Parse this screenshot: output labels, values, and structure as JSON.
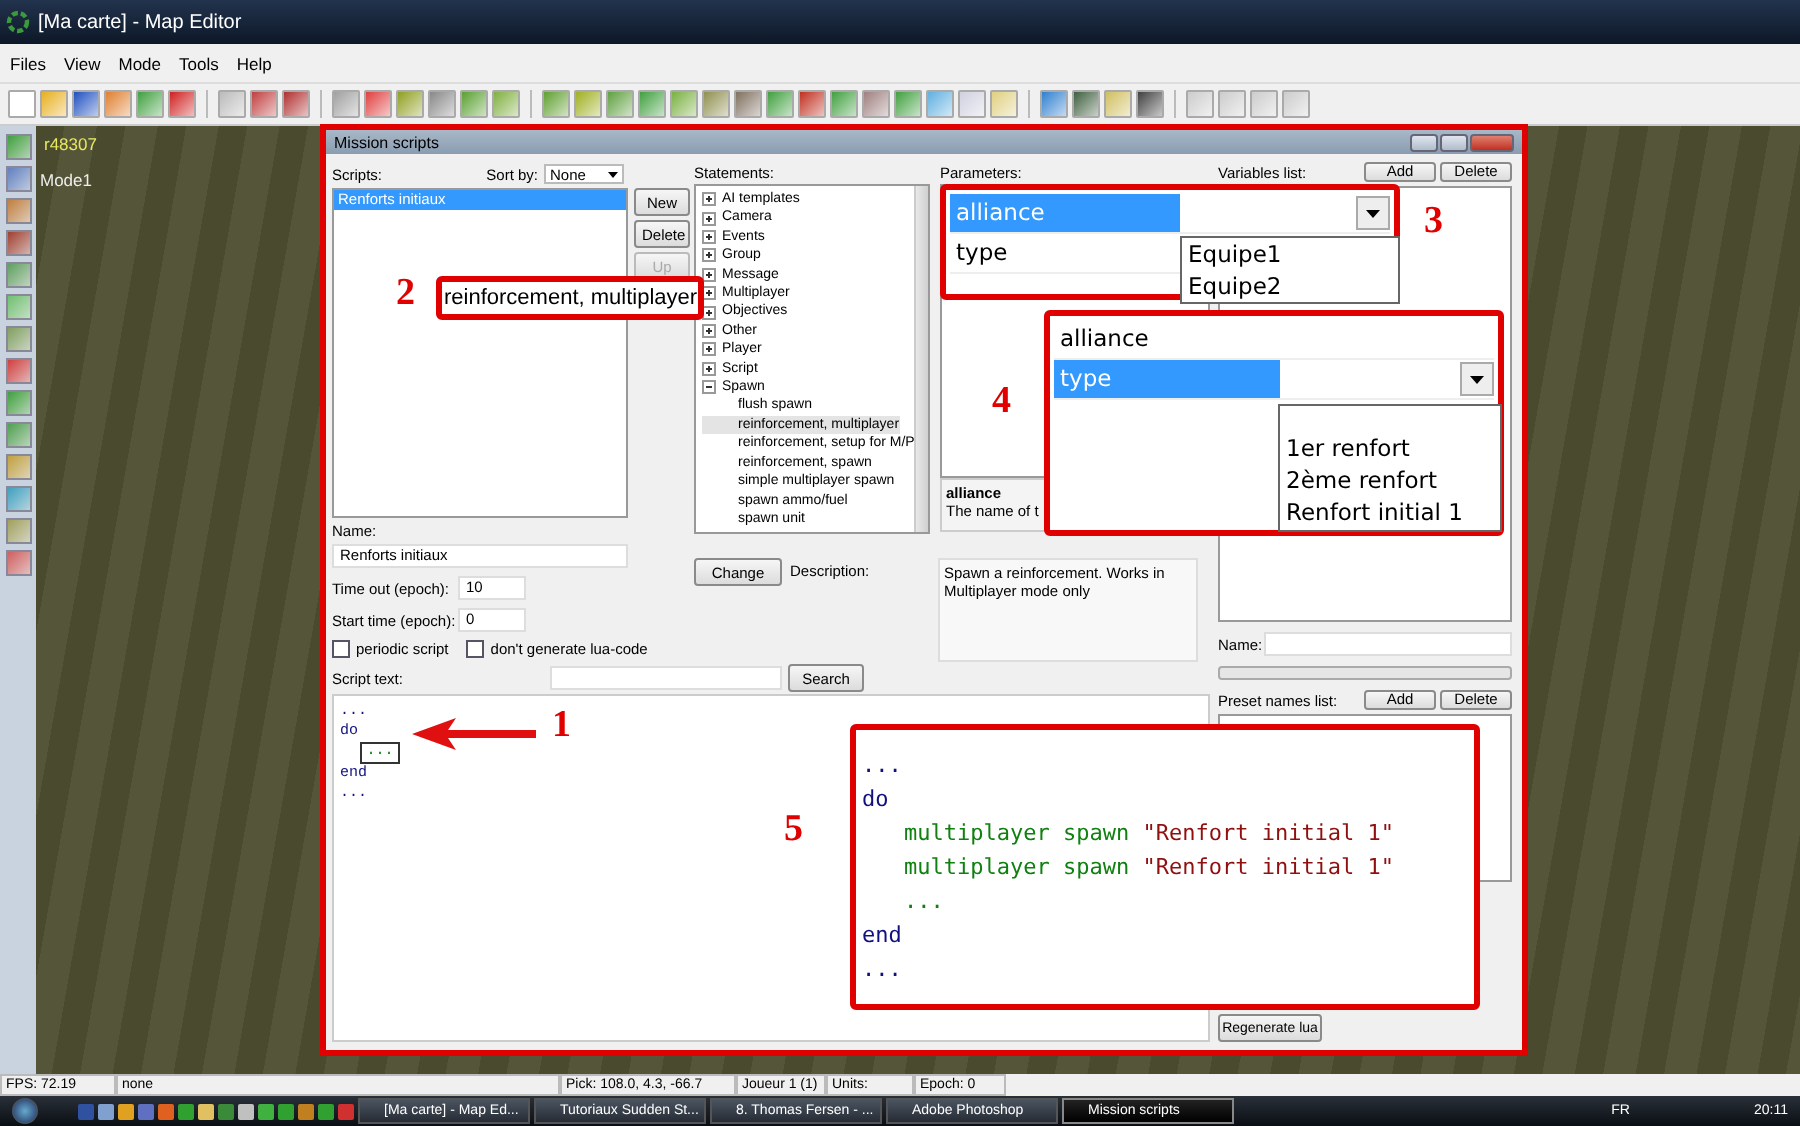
{
  "window": {
    "title": "[Ma carte] - Map Editor"
  },
  "menu": [
    "Files",
    "View",
    "Mode",
    "Tools",
    "Help"
  ],
  "map_view": {
    "labels": [
      "r48307",
      "Mode1"
    ]
  },
  "dialog": {
    "title": "Mission scripts",
    "scripts": {
      "label": "Scripts:",
      "sort_label": "Sort by:",
      "sort_value": "None",
      "items": [
        {
          "label": "Renforts initiaux",
          "selected": true
        }
      ]
    },
    "script_buttons": [
      {
        "label": "New",
        "disabled": false
      },
      {
        "label": "Delete",
        "disabled": false
      },
      {
        "label": "Up",
        "disabled": true
      }
    ],
    "name": {
      "label": "Name:",
      "value": "Renforts initiaux"
    },
    "timeout": {
      "label": "Time out (epoch):",
      "value": "10"
    },
    "start_time": {
      "label": "Start time (epoch):",
      "value": "0"
    },
    "options": [
      {
        "label": "periodic script",
        "checked": false
      },
      {
        "label": "don't generate lua-code",
        "checked": false
      }
    ],
    "script_text": {
      "label": "Script text:",
      "search_button": "Search"
    },
    "script_lines": [
      {
        "kind": "keyword",
        "text": "..."
      },
      {
        "kind": "keyword",
        "text": "do"
      },
      {
        "kind": "slot",
        "text": "..."
      },
      {
        "kind": "keyword",
        "text": "end"
      },
      {
        "kind": "keyword",
        "text": "..."
      }
    ],
    "statements": {
      "label": "Statements:",
      "tree": [
        {
          "label": "AI templates",
          "expanded": false
        },
        {
          "label": "Camera",
          "expanded": false
        },
        {
          "label": "Events",
          "expanded": false
        },
        {
          "label": "Group",
          "expanded": false
        },
        {
          "label": "Message",
          "expanded": false
        },
        {
          "label": "Multiplayer",
          "expanded": false
        },
        {
          "label": "Objectives",
          "expanded": false
        },
        {
          "label": "Other",
          "expanded": false
        },
        {
          "label": "Player",
          "expanded": false
        },
        {
          "label": "Script",
          "expanded": false
        },
        {
          "label": "Spawn",
          "expanded": true,
          "children": [
            {
              "label": "flush spawn",
              "selected": false
            },
            {
              "label": "reinforcement, multiplayer",
              "selected": true
            },
            {
              "label": "reinforcement, setup for M/P",
              "selected": false
            },
            {
              "label": "reinforcement, spawn",
              "selected": false
            },
            {
              "label": "simple multiplayer spawn",
              "selected": false
            },
            {
              "label": "spawn ammo/fuel",
              "selected": false
            },
            {
              "label": "spawn unit",
              "selected": false
            }
          ]
        }
      ]
    },
    "change_button": "Change",
    "description": {
      "label": "Description:",
      "text": "Spawn a reinforcement. Works in Multiplayer mode only"
    },
    "parameters": {
      "label": "Parameters:",
      "help_title": "alliance",
      "help_text": "The name of t"
    },
    "variables": {
      "label": "Variables list:",
      "add": "Add",
      "delete": "Delete"
    },
    "var_name": {
      "label": "Name:"
    },
    "presets": {
      "label": "Preset names list:",
      "add": "Add",
      "delete": "Delete"
    },
    "regenerate_button": "Regenerate lua"
  },
  "callouts": [
    {
      "kind": "label",
      "number": "2",
      "text": "reinforcement, multiplayer"
    },
    {
      "kind": "grid",
      "number": "3",
      "rows": [
        {
          "name": "alliance",
          "selected": true
        },
        {
          "name": "type",
          "selected": false
        }
      ],
      "options": [
        "Equipe1",
        "Equipe2"
      ]
    },
    {
      "kind": "grid",
      "number": "4",
      "rows": [
        {
          "name": "alliance",
          "selected": false
        },
        {
          "name": "type",
          "selected": true
        }
      ],
      "options": [
        "1er renfort",
        "2ème renfort",
        "Renfort initial 1"
      ]
    },
    {
      "kind": "arrow",
      "number": "1"
    },
    {
      "kind": "code",
      "number": "5",
      "lines": [
        {
          "kind": "keyword",
          "text": "..."
        },
        {
          "kind": "keyword",
          "text": "do"
        },
        {
          "kind": "call",
          "command": "multiplayer spawn",
          "argument": "\"Renfort initial 1\""
        },
        {
          "kind": "call",
          "command": "multiplayer spawn",
          "argument": "\"Renfort initial 1\""
        },
        {
          "kind": "placeholder",
          "text": "..."
        },
        {
          "kind": "keyword",
          "text": "end"
        },
        {
          "kind": "keyword",
          "text": "..."
        }
      ]
    }
  ],
  "status_bar": [
    "FPS: 72.19",
    "none",
    "Pick: 108.0, 4.3, -66.7",
    "Joueur 1 (1)",
    "Units:",
    "Epoch: 0"
  ],
  "taskbar": {
    "tasks": [
      {
        "label": "[Ma carte] - Map Ed...",
        "selected": false
      },
      {
        "label": "Tutoriaux Sudden St...",
        "selected": false
      },
      {
        "label": "8. Thomas Fersen - ...",
        "selected": false
      },
      {
        "label": "Adobe Photoshop",
        "selected": false
      },
      {
        "label": "Mission scripts",
        "selected": true
      }
    ],
    "language": "FR",
    "clock": "20:11"
  }
}
